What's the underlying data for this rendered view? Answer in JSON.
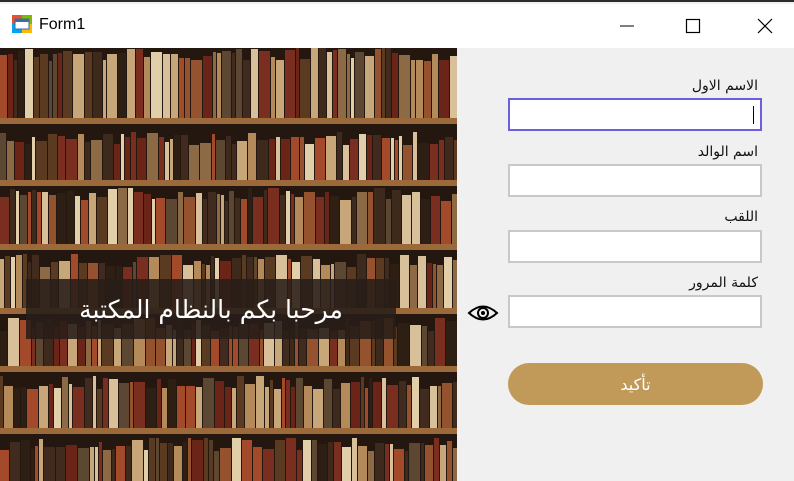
{
  "window": {
    "title": "Form1",
    "controls": [
      "minimize",
      "maximize",
      "close"
    ]
  },
  "banner": {
    "welcome_text": "مرحبا بكم بالنظام المكتبة",
    "image_description_icon": "bookshelf-photo"
  },
  "form": {
    "first_name_label": "الاسم الاول",
    "first_name_value": "",
    "father_name_label": "اسم الوالد",
    "father_name_value": "",
    "surname_label": "اللقب",
    "surname_value": "",
    "password_label": "كلمة المرور",
    "password_value": "",
    "submit_label": "تأكيد"
  },
  "colors": {
    "accent_button": "#c19a59",
    "focus_border": "#6b5fe0",
    "field_border": "#c8c8c8"
  }
}
